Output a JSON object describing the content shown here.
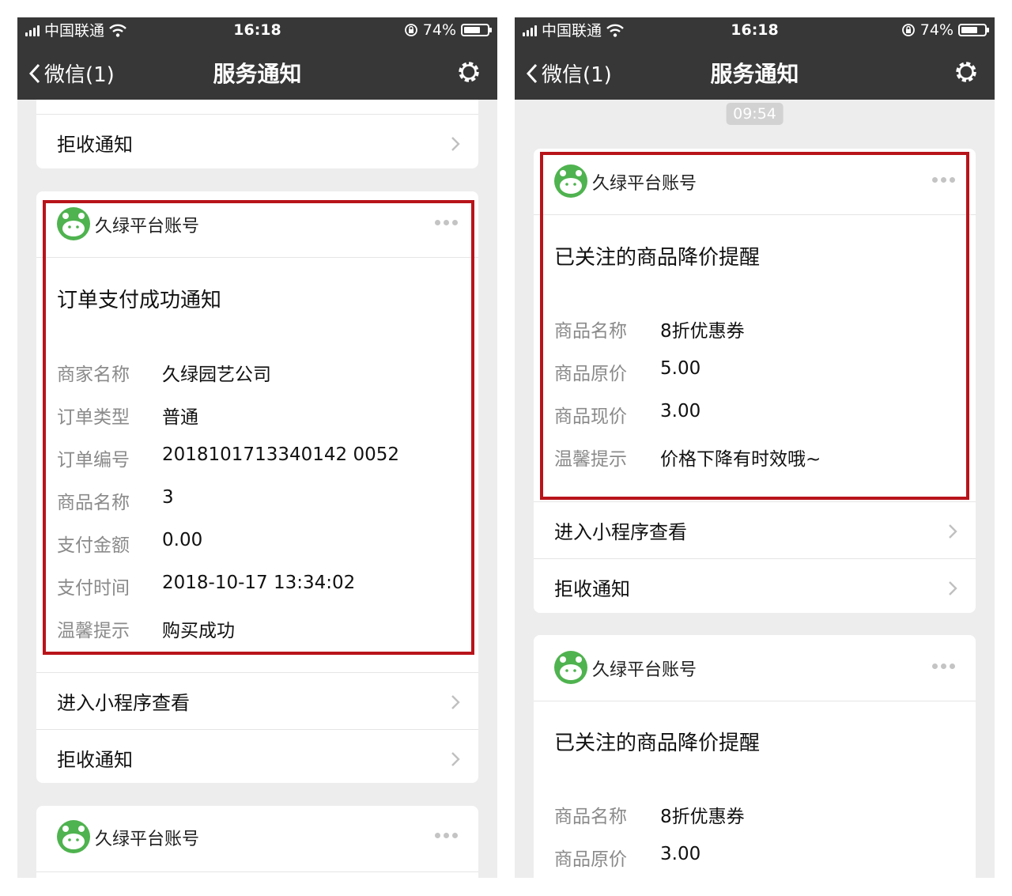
{
  "status_bar": {
    "carrier": "中国联通",
    "time": "16:18",
    "battery": "74%",
    "battery_level": 0.74
  },
  "nav": {
    "back_label": "微信(1)",
    "title": "服务通知"
  },
  "left": {
    "top_card": {
      "reject_label": "拒收通知"
    },
    "order_card": {
      "account": "久绿平台账号",
      "title": "订单支付成功通知",
      "fields": [
        {
          "label": "商家名称",
          "value": "久绿园艺公司"
        },
        {
          "label": "订单类型",
          "value": "普通"
        },
        {
          "label": "订单编号",
          "value": "2018101713340142 0052"
        },
        {
          "label": "商品名称",
          "value": "3"
        },
        {
          "label": "支付金额",
          "value": "0.00"
        },
        {
          "label": "支付时间",
          "value": "2018-10-17 13:34:02"
        },
        {
          "label": "温馨提示",
          "value": "购买成功"
        }
      ],
      "actions": [
        "进入小程序查看",
        "拒收通知"
      ]
    },
    "bottom_card": {
      "account": "久绿平台账号"
    }
  },
  "right": {
    "time_label": "09:54",
    "price_card": {
      "account": "久绿平台账号",
      "title": "已关注的商品降价提醒",
      "fields": [
        {
          "label": "商品名称",
          "value": "8折优惠券"
        },
        {
          "label": "商品原价",
          "value": "5.00"
        },
        {
          "label": "商品现价",
          "value": "3.00"
        },
        {
          "label": "温馨提示",
          "value": "价格下降有时效哦~"
        }
      ],
      "actions": [
        "进入小程序查看",
        "拒收通知"
      ]
    },
    "second_card": {
      "account": "久绿平台账号",
      "title": "已关注的商品降价提醒",
      "fields": [
        {
          "label": "商品名称",
          "value": "8折优惠券"
        },
        {
          "label": "商品原价",
          "value": "3.00"
        }
      ]
    }
  },
  "colors": {
    "nav_bg": "#373737",
    "page_bg": "#ededed",
    "highlight": "#b8141a",
    "avatar_green": "#4fb34f"
  }
}
